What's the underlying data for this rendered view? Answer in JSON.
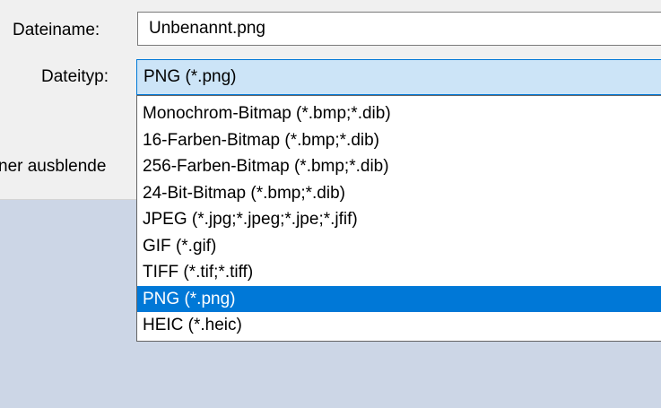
{
  "form": {
    "filename_label": "Dateiname:",
    "filename_value": "Unbenannt.png",
    "filetype_label": "Dateityp:",
    "filetype_value": "PNG (*.png)",
    "hide_folders_label": "ner ausblende"
  },
  "dropdown": {
    "selected_index": 7,
    "options": [
      "Monochrom-Bitmap (*.bmp;*.dib)",
      "16-Farben-Bitmap (*.bmp;*.dib)",
      "256-Farben-Bitmap (*.bmp;*.dib)",
      "24-Bit-Bitmap (*.bmp;*.dib)",
      "JPEG (*.jpg;*.jpeg;*.jpe;*.jfif)",
      "GIF (*.gif)",
      "TIFF (*.tif;*.tiff)",
      "PNG (*.png)",
      "HEIC (*.heic)"
    ]
  },
  "colors": {
    "selection": "#0078d7",
    "combo_highlight": "#cce4f7",
    "dialog_background": "#f0f0f0",
    "backdrop": "#ccd6e6"
  }
}
